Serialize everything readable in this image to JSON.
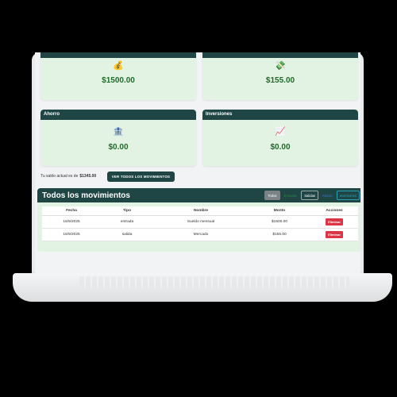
{
  "cards": [
    {
      "title": "",
      "icon": "money-bag-icon",
      "glyph": "💰",
      "amount": "$1500.00"
    },
    {
      "title": "",
      "icon": "money-wings-icon",
      "glyph": "💸",
      "amount": "$155.00"
    },
    {
      "title": "Ahorro",
      "icon": "bank-icon",
      "glyph": "🏦",
      "amount": "$0.00"
    },
    {
      "title": "Inversiones",
      "icon": "chart-increasing-icon",
      "glyph": "📈",
      "amount": "$0.00"
    }
  ],
  "balance": {
    "label": "Tu saldo actual es de",
    "amount": "$1345.00",
    "button_label": "VER TODOS LOS MOVIMIENTOS"
  },
  "movements": {
    "title": "Todos los movimientos",
    "filters": [
      "Todos",
      "Entradas",
      "Salidas",
      "Ahorro",
      "Inversiones"
    ],
    "active_filter": "Todos",
    "columns": [
      "Fecha",
      "Tipo",
      "Nombre",
      "Monto",
      "Acciones"
    ],
    "rows": [
      {
        "fecha": "16/9/2025",
        "tipo": "entrada",
        "nombre": "Sueldo mensual",
        "monto": "$1500.00",
        "accion": "Eliminar"
      },
      {
        "fecha": "16/9/2025",
        "tipo": "salida",
        "nombre": "Mercado",
        "monto": "$155.00",
        "accion": "Eliminar"
      }
    ]
  },
  "colors": {
    "header": "#1f4545",
    "card_bg": "#e3f3e3",
    "amount": "#1f6b2a",
    "delete": "#dc3545"
  }
}
